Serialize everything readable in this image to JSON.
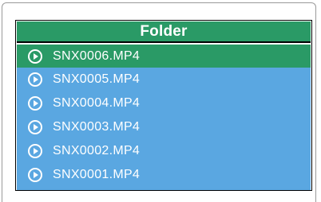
{
  "header": {
    "title": "Folder"
  },
  "files": [
    {
      "name": "SNX0006.MP4",
      "selected": true
    },
    {
      "name": "SNX0005.MP4",
      "selected": false
    },
    {
      "name": "SNX0004.MP4",
      "selected": false
    },
    {
      "name": "SNX0003.MP4",
      "selected": false
    },
    {
      "name": "SNX0002.MP4",
      "selected": false
    },
    {
      "name": "SNX0001.MP4",
      "selected": false
    }
  ],
  "colors": {
    "header_bg": "#2a9a66",
    "list_bg": "#5aa7e1",
    "selected_bg": "#2a9a66",
    "text": "#ffffff"
  },
  "icons": {
    "file": "play-circle-icon"
  }
}
